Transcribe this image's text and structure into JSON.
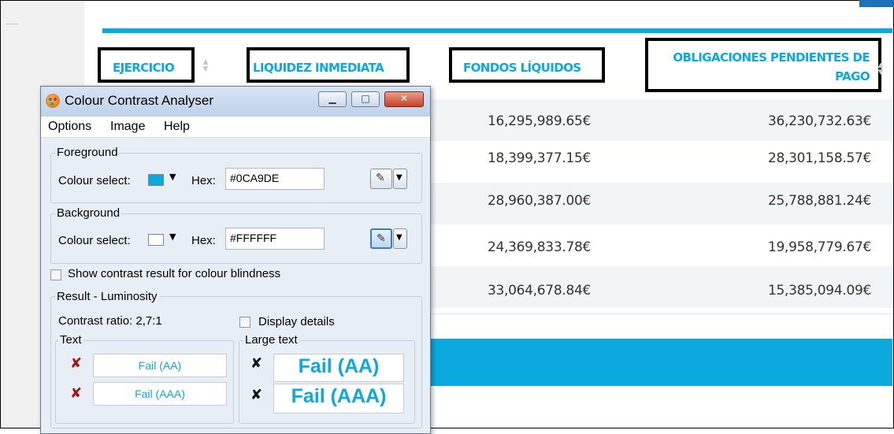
{
  "table": {
    "headers": {
      "ejercicio": "EJERCICIO",
      "liquidez": "LIQUIDEZ INMEDIATA",
      "fondos": "FONDOS LÍQUIDOS",
      "obligaciones_line1": "OBLIGACIONES PENDIENTES DE",
      "obligaciones_line2": "PAGO"
    },
    "rows": [
      {
        "fondos": "16,295,989.65€",
        "obligaciones": "36,230,732.63€"
      },
      {
        "fondos": "18,399,377.15€",
        "obligaciones": "28,301,158.57€"
      },
      {
        "fondos": "28,960,387.00€",
        "obligaciones": "25,788,881.24€"
      },
      {
        "fondos": "24,369,833.78€",
        "obligaciones": "19,958,779.67€"
      },
      {
        "fondos": "33,064,678.84€",
        "obligaciones": "15,385,094.09€"
      }
    ]
  },
  "dialog": {
    "title": "Colour Contrast Analyser",
    "window_buttons": {
      "minimize": "▁",
      "maximize": "□",
      "close": "✕"
    },
    "menu": [
      "Options",
      "Image",
      "Help"
    ],
    "foreground": {
      "group_label": "Foreground",
      "colour_select_label": "Colour select:",
      "hex_label": "Hex:",
      "hex_value": "#0CA9DE",
      "swatch_color": "#0CA9DE"
    },
    "background": {
      "group_label": "Background",
      "colour_select_label": "Colour select:",
      "hex_label": "Hex:",
      "hex_value": "#FFFFFF",
      "swatch_color": "#FFFFFF"
    },
    "blindness_checkbox_label": "Show contrast result for colour blindness",
    "result": {
      "group_label": "Result - Luminosity",
      "contrast_ratio": "Contrast ratio: 2,7:1",
      "display_details_label": "Display details",
      "text_label": "Text",
      "large_text_label": "Large text",
      "text_aa": "Fail (AA)",
      "text_aaa": "Fail (AAA)",
      "large_aa": "Fail (AA)",
      "large_aaa": "Fail (AAA)",
      "fail_symbol": "✘"
    }
  },
  "colors": {
    "accent": "#0CA9DE",
    "outline": "#000000",
    "row_alt": "#F1F5F8"
  },
  "icons": {
    "sort": "sort-icon",
    "app": "palette-icon",
    "picker": "eyedropper-icon",
    "fail": "cross-icon"
  }
}
